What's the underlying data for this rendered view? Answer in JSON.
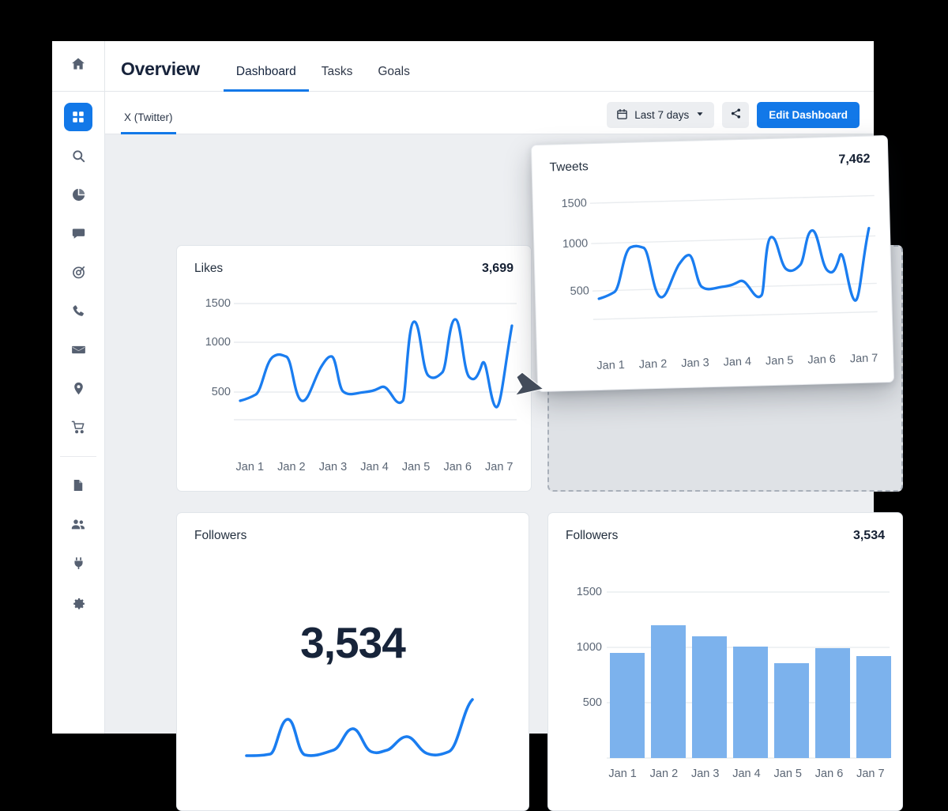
{
  "header": {
    "title": "Overview",
    "tabs": [
      {
        "label": "Dashboard",
        "active": true
      },
      {
        "label": "Tasks",
        "active": false
      },
      {
        "label": "Goals",
        "active": false
      }
    ]
  },
  "subheader": {
    "subtabs": [
      {
        "label": "X (Twitter)",
        "active": true
      }
    ],
    "date_picker": {
      "label": "Last 7 days",
      "icon": "calendar-icon",
      "chevron": "chevron-down-icon"
    },
    "share_icon": "share-icon",
    "edit_button": "Edit Dashboard"
  },
  "sidebar": {
    "top": {
      "icon": "home-icon"
    },
    "items": [
      {
        "icon": "grid-icon",
        "name": "dashboard",
        "active": true
      },
      {
        "icon": "search-icon",
        "name": "search",
        "active": false
      },
      {
        "icon": "pie-chart-icon",
        "name": "analytics",
        "active": false
      },
      {
        "icon": "chat-bubble-icon",
        "name": "messages",
        "active": false
      },
      {
        "icon": "target-icon",
        "name": "campaigns",
        "active": false
      },
      {
        "icon": "phone-icon",
        "name": "calls",
        "active": false
      },
      {
        "icon": "envelope-icon",
        "name": "email",
        "active": false
      },
      {
        "icon": "location-pin-icon",
        "name": "locations",
        "active": false
      },
      {
        "icon": "shopping-cart-icon",
        "name": "commerce",
        "active": false
      },
      {
        "icon": "divider",
        "name": "divider",
        "active": false
      },
      {
        "icon": "document-icon",
        "name": "reports",
        "active": false
      },
      {
        "icon": "people-icon",
        "name": "contacts",
        "active": false
      },
      {
        "icon": "plug-icon",
        "name": "integrations",
        "active": false
      },
      {
        "icon": "gear-icon",
        "name": "settings",
        "active": false
      }
    ]
  },
  "colors": {
    "accent_blue": "#1278e8",
    "line_blue": "#1a7df0",
    "bar_blue": "#7cb2ed",
    "board_background": "#edeff2",
    "text_dark": "#17243a",
    "text_muted": "#5b6675"
  },
  "cards": {
    "likes": {
      "title": "Likes",
      "value": "3,699"
    },
    "tweets": {
      "title": "Tweets",
      "value": "7,462"
    },
    "followers_big": {
      "title": "Followers",
      "value": "3,534"
    },
    "followers_bar": {
      "title": "Followers",
      "value": "3,534"
    }
  },
  "chart_data": [
    {
      "id": "likes-line-chart",
      "type": "line",
      "title": "Likes",
      "xlabel": "",
      "ylabel": "",
      "ylim": [
        0,
        1700
      ],
      "yticks": [
        500,
        1000,
        1500
      ],
      "grid": true,
      "legend": "none",
      "categories": [
        "Jan 1",
        "Jan 2",
        "Jan 3",
        "Jan 4",
        "Jan 5",
        "Jan 6",
        "Jan 7"
      ],
      "x": [
        0,
        0.25,
        0.5,
        0.75,
        1,
        1.3,
        1.6,
        1.9,
        2.2,
        2.5,
        2.8,
        3.1,
        3.4,
        3.7,
        4,
        4.2,
        4.45,
        4.7,
        4.95,
        5.2,
        5.45,
        5.7,
        6
      ],
      "values": [
        600,
        630,
        700,
        1100,
        1100,
        590,
        700,
        1080,
        680,
        665,
        690,
        700,
        760,
        740,
        590,
        1450,
        800,
        820,
        1470,
        790,
        950,
        505,
        1390
      ],
      "total": 3699
    },
    {
      "id": "tweets-line-chart",
      "type": "line",
      "title": "Tweets",
      "xlabel": "",
      "ylabel": "",
      "ylim": [
        0,
        1700
      ],
      "yticks": [
        500,
        1000,
        1500
      ],
      "grid": true,
      "legend": "none",
      "categories": [
        "Jan 1",
        "Jan 2",
        "Jan 3",
        "Jan 4",
        "Jan 5",
        "Jan 6",
        "Jan 7"
      ],
      "x": [
        0,
        0.25,
        0.5,
        0.75,
        1,
        1.3,
        1.6,
        1.9,
        2.2,
        2.5,
        2.8,
        3.1,
        3.4,
        3.7,
        4,
        4.2,
        4.45,
        4.7,
        4.95,
        5.2,
        5.45,
        5.7,
        6
      ],
      "values": [
        600,
        630,
        700,
        1130,
        1120,
        575,
        680,
        990,
        670,
        660,
        690,
        700,
        760,
        735,
        570,
        1150,
        800,
        820,
        1230,
        760,
        960,
        470,
        1240
      ],
      "total": 7462
    },
    {
      "id": "followers-sparkline",
      "type": "line",
      "title": "Followers",
      "xlabel": "",
      "ylabel": "",
      "grid": false,
      "legend": "none",
      "x": [
        0,
        0.6,
        1.1,
        1.5,
        1.9,
        2.4,
        2.9,
        3.4,
        3.8,
        4.3,
        4.8,
        5.3,
        5.7,
        6
      ],
      "values": [
        190,
        200,
        210,
        640,
        195,
        250,
        560,
        310,
        290,
        440,
        250,
        215,
        300,
        800
      ],
      "total": 3534
    },
    {
      "id": "followers-bar-chart",
      "type": "bar",
      "title": "Followers",
      "xlabel": "",
      "ylabel": "",
      "ylim": [
        0,
        1700
      ],
      "yticks": [
        500,
        1000,
        1500
      ],
      "grid": true,
      "legend": "none",
      "categories": [
        "Jan 1",
        "Jan 2",
        "Jan 3",
        "Jan 4",
        "Jan 5",
        "Jan 6",
        "Jan 7"
      ],
      "values": [
        950,
        1200,
        1100,
        1005,
        860,
        995,
        925
      ],
      "total": 3534
    }
  ]
}
